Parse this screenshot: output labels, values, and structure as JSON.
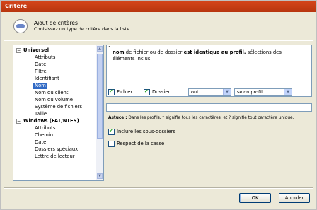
{
  "window": {
    "title": "Critère"
  },
  "header": {
    "icon": "speech-bubble-icon",
    "title": "Ajout de critères",
    "subtitle": "Choisissez un type de critère dans la liste."
  },
  "tree": {
    "items": [
      {
        "label": "Universel",
        "group": true
      },
      {
        "label": "Attributs"
      },
      {
        "label": "Date"
      },
      {
        "label": "Filtre"
      },
      {
        "label": "Identifiant"
      },
      {
        "label": "Nom",
        "selected": true
      },
      {
        "label": "Nom du client"
      },
      {
        "label": "Nom du volume"
      },
      {
        "label": "Système de fichiers"
      },
      {
        "label": "Taille"
      },
      {
        "label": "Windows (FAT/NTFS)",
        "group": true
      },
      {
        "label": "Attributs"
      },
      {
        "label": "Chemin"
      },
      {
        "label": "Date"
      },
      {
        "label": "Dossiers spéciaux"
      },
      {
        "label": "Lettre de lecteur"
      }
    ]
  },
  "description": {
    "bold_start": "nom",
    "text_mid": " de fichier ou de dossier ",
    "bold_mid": "est identique au profil,",
    "text_end": " sélections des",
    "line2": "éléments inclus"
  },
  "options": {
    "fichier_label": "Fichier",
    "dossier_label": "Dossier",
    "match_value": "oui",
    "profile_value": "selon profil"
  },
  "pattern": {
    "value": ""
  },
  "tip": {
    "label": "Astuce :",
    "text": "Dans les profils, * signifie tous les caractères, et ? signifie tout caractère unique."
  },
  "checks": {
    "subfolders_label": "Inclure les sous-dossiers",
    "case_label": "Respect de la casse"
  },
  "buttons": {
    "ok": "OK",
    "cancel": "Annuler"
  },
  "colors": {
    "titlebar": "#c9421a",
    "selection": "#316ac5",
    "border": "#7f9db9"
  }
}
